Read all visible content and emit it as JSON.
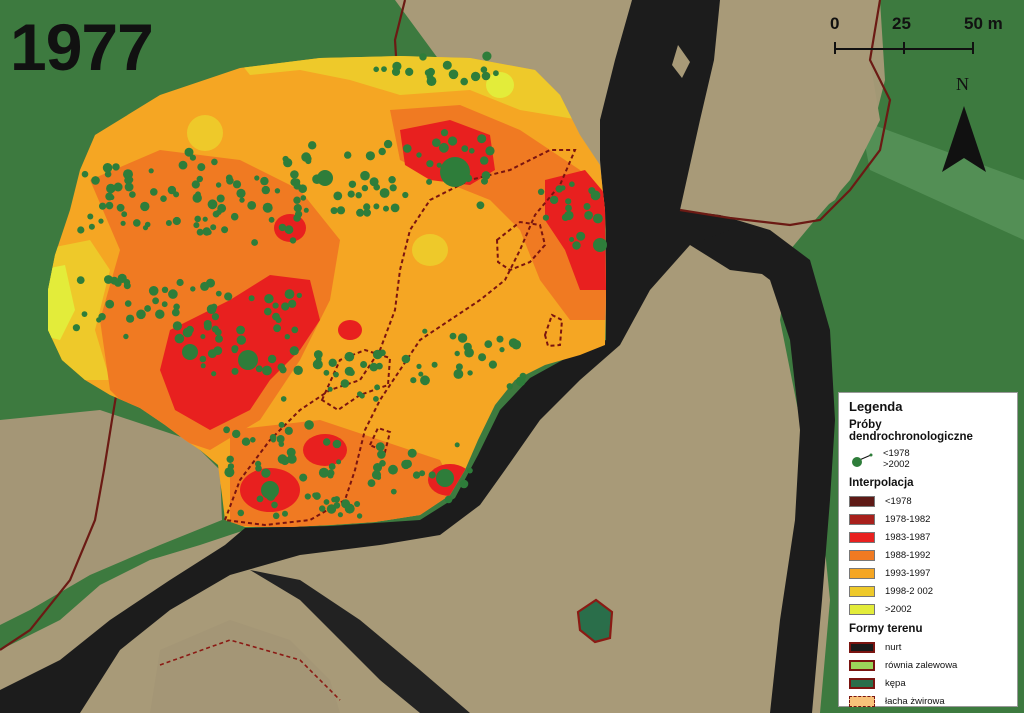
{
  "year": "1977",
  "scale": {
    "labels": [
      "0",
      "25",
      "50 m"
    ]
  },
  "north_label": "N",
  "legend": {
    "title": "Legenda",
    "samples_section": "Próby dendrochronologiczne",
    "sample_labels": [
      "<1978",
      ">2002"
    ],
    "interpolation_section": "Interpolacja",
    "interpolation_classes": [
      {
        "label": "<1978",
        "color": "#5e1a16"
      },
      {
        "label": "1978-1982",
        "color": "#a8201c"
      },
      {
        "label": "1983-1987",
        "color": "#e8201f"
      },
      {
        "label": "1988-1992",
        "color": "#f07a22"
      },
      {
        "label": "1993-1997",
        "color": "#f5a623"
      },
      {
        "label": "1998-2 002",
        "color": "#eec92a"
      },
      {
        "label": ">2002",
        "color": "#e3ec3a"
      }
    ],
    "landforms_section": "Formy terenu",
    "landforms": [
      {
        "label": "nurt",
        "color": "#1a1a1a",
        "style": "fill-border"
      },
      {
        "label": "równia zalewowa",
        "color": "#9bd45a",
        "style": "fill-border"
      },
      {
        "label": "kępa",
        "color": "#2a6e4a",
        "style": "fill-border"
      },
      {
        "label": "łacha żwirowa",
        "color": "#f8c27a",
        "style": "dashed"
      }
    ]
  },
  "colors": {
    "forest": "#3d7a3f",
    "gravel": "#a89a78",
    "channel": "#1c1c1c",
    "sample_point": "#2e7d3a",
    "boundary": "#6b1a14"
  }
}
